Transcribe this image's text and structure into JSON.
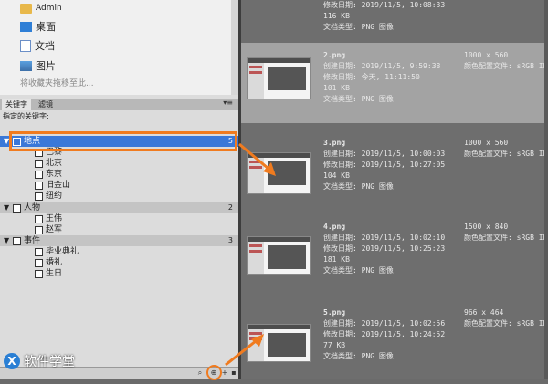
{
  "favorites": {
    "items": [
      {
        "label": "Admin",
        "icon": "folder-icon"
      },
      {
        "label": "桌面",
        "icon": "desktop-icon"
      },
      {
        "label": "文档",
        "icon": "document-icon"
      },
      {
        "label": "图片",
        "icon": "pictures-icon"
      }
    ],
    "hint": "将收藏夹拖移至此..."
  },
  "tabs": [
    {
      "label": "关键字",
      "active": true
    },
    {
      "label": "滤镜",
      "active": false
    }
  ],
  "keywords_header": "指定的关键字:",
  "keywords": [
    {
      "label": "地点",
      "type": "category",
      "count": "5",
      "selected": true
    },
    {
      "label": "巴黎",
      "type": "item"
    },
    {
      "label": "北京",
      "type": "item"
    },
    {
      "label": "东京",
      "type": "item"
    },
    {
      "label": "旧金山",
      "type": "item"
    },
    {
      "label": "纽约",
      "type": "item"
    },
    {
      "label": "人物",
      "type": "category",
      "count": "2",
      "selected": false
    },
    {
      "label": "王伟",
      "type": "item"
    },
    {
      "label": "赵军",
      "type": "item"
    },
    {
      "label": "事件",
      "type": "category",
      "count": "3",
      "selected": false
    },
    {
      "label": "毕业典礼",
      "type": "item"
    },
    {
      "label": "婚礼",
      "type": "item"
    },
    {
      "label": "生日",
      "type": "item"
    }
  ],
  "bottom_buttons": [
    "search-icon",
    "new-sub-keyword-icon",
    "new-keyword-icon",
    "delete-icon"
  ],
  "brand": {
    "text": "软件学堂",
    "logo": "X"
  },
  "files": [
    {
      "name": "",
      "created": "",
      "modified": "修改日期: 2019/11/5, 10:08:33",
      "size": "116 KB",
      "type": "文档类型: PNG 图像",
      "dims": "",
      "profile": "",
      "selected": false
    },
    {
      "name": "2.png",
      "created": "创建日期: 2019/11/5, 9:59:38",
      "modified": "修改日期: 今天, 11:11:50",
      "size": "101 KB",
      "type": "文档类型: PNG 图像",
      "dims": "1000 x 560",
      "profile": "颜色配置文件: sRGB IE",
      "selected": true
    },
    {
      "name": "3.png",
      "created": "创建日期: 2019/11/5, 10:00:03",
      "modified": "修改日期: 2019/11/5, 10:27:05",
      "size": "104 KB",
      "type": "文档类型: PNG 图像",
      "dims": "1000 x 560",
      "profile": "颜色配置文件: sRGB IE",
      "selected": false
    },
    {
      "name": "4.png",
      "created": "创建日期: 2019/11/5, 10:02:10",
      "modified": "修改日期: 2019/11/5, 10:25:23",
      "size": "181 KB",
      "type": "文档类型: PNG 图像",
      "dims": "1500 x 840",
      "profile": "颜色配置文件: sRGB IE",
      "selected": false
    },
    {
      "name": "5.png",
      "created": "创建日期: 2019/11/5, 10:02:56",
      "modified": "修改日期: 2019/11/5, 10:24:52",
      "size": "77 KB",
      "type": "文档类型: PNG 图像",
      "dims": "966 x 464",
      "profile": "颜色配置文件: sRGB IE",
      "selected": false
    }
  ],
  "colors": {
    "accent": "#f07b1f",
    "selection": "#3a78d8"
  }
}
